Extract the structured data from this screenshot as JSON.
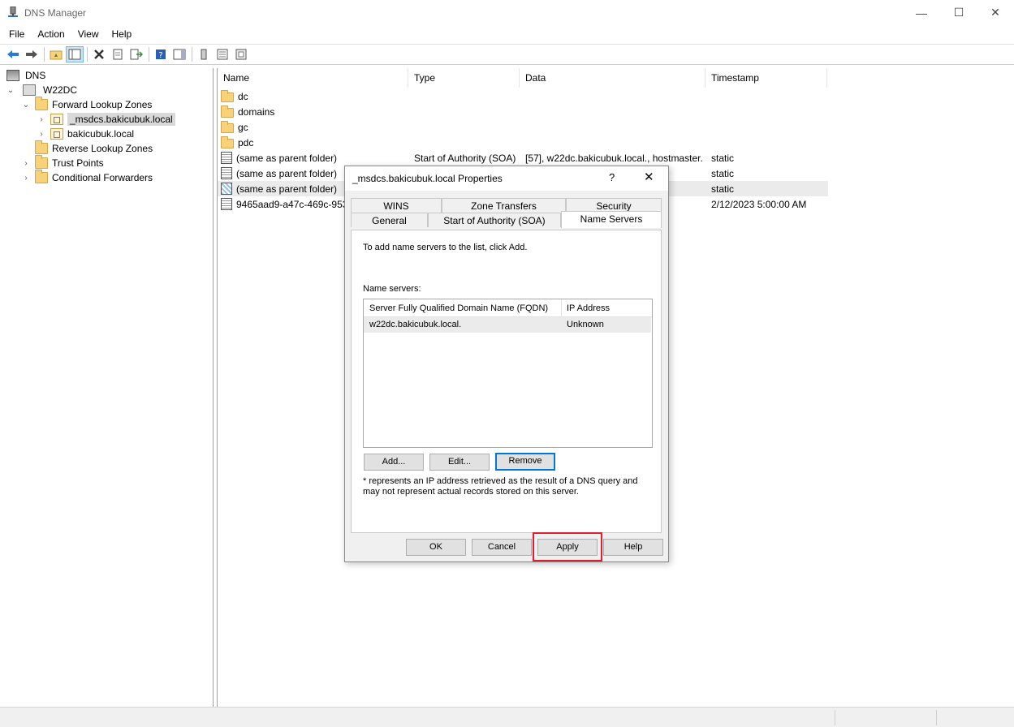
{
  "window": {
    "title": "DNS Manager",
    "minimize_glyph": "—",
    "maximize_glyph": "☐",
    "close_glyph": "✕"
  },
  "menu": [
    "File",
    "Action",
    "View",
    "Help"
  ],
  "toolbar": {
    "icons": [
      "back-arrow-icon",
      "forward-arrow-icon",
      "up-folder-icon",
      "show-hide-tree-icon",
      "delete-icon",
      "properties-icon",
      "export-list-icon",
      "help-icon",
      "action-pane-icon",
      "server-icon",
      "zone-list-icon",
      "records-icon"
    ]
  },
  "tree": {
    "root": "DNS",
    "server": "W22DC",
    "forward_zones": "Forward Lookup Zones",
    "zone_msdcs": "_msdcs.bakicubuk.local",
    "zone_main": "bakicubuk.local",
    "reverse_zones": "Reverse Lookup Zones",
    "trust_points": "Trust Points",
    "conditional_forwarders": "Conditional Forwarders"
  },
  "list": {
    "columns": {
      "name": "Name",
      "type": "Type",
      "data": "Data",
      "timestamp": "Timestamp"
    },
    "rows": [
      {
        "name": "dc",
        "type": "",
        "data": "",
        "timestamp": "",
        "icon": "folder"
      },
      {
        "name": "domains",
        "type": "",
        "data": "",
        "timestamp": "",
        "icon": "folder"
      },
      {
        "name": "gc",
        "type": "",
        "data": "",
        "timestamp": "",
        "icon": "folder"
      },
      {
        "name": "pdc",
        "type": "",
        "data": "",
        "timestamp": "",
        "icon": "folder"
      },
      {
        "name": "(same as parent folder)",
        "type": "Start of Authority (SOA)",
        "data": "[57], w22dc.bakicubuk.local., hostmaster.",
        "timestamp": "static",
        "icon": "record"
      },
      {
        "name": "(same as parent folder)",
        "type": "",
        "data": "",
        "timestamp": "static",
        "icon": "record"
      },
      {
        "name": "(same as parent folder)",
        "type": "",
        "data": "",
        "timestamp": "static",
        "icon": "record-blue"
      },
      {
        "name": "9465aad9-a47c-469c-953f",
        "type": "",
        "data": "",
        "timestamp": "2/12/2023 5:00:00 AM",
        "icon": "record"
      }
    ]
  },
  "dialog": {
    "title": "_msdcs.bakicubuk.local Properties",
    "help_glyph": "?",
    "close_glyph": "✕",
    "tabs_back": [
      "WINS",
      "Zone Transfers",
      "Security"
    ],
    "tabs_front": [
      "General",
      "Start of Authority (SOA)",
      "Name Servers"
    ],
    "active_tab": "Name Servers",
    "intro": "To add name servers to the list, click Add.",
    "ns_label": "Name servers:",
    "ns_columns": {
      "fqdn": "Server Fully Qualified Domain Name (FQDN)",
      "ip": "IP Address"
    },
    "ns_rows": [
      {
        "fqdn": "w22dc.bakicubuk.local.",
        "ip": "Unknown"
      }
    ],
    "add_label": "Add...",
    "edit_label": "Edit...",
    "remove_label": "Remove",
    "note": "* represents an IP address retrieved as the result of a DNS query and may not represent actual records stored on this server.",
    "ok_label": "OK",
    "cancel_label": "Cancel",
    "apply_label": "Apply",
    "help_label": "Help",
    "highlight_color": "#e01e2e"
  }
}
